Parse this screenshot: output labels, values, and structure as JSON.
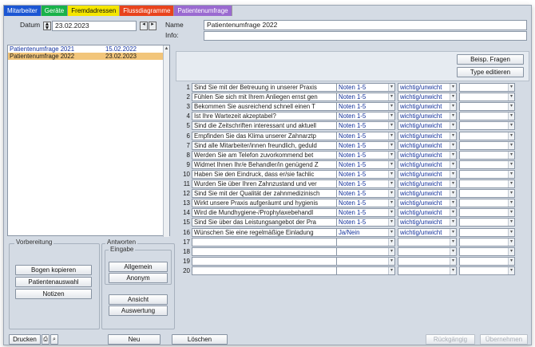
{
  "tabs": [
    {
      "label": "Mitarbeiter",
      "bg": "#1b56d3",
      "fg": "#ffffff"
    },
    {
      "label": "Geräte",
      "bg": "#19b24a",
      "fg": "#ffffff"
    },
    {
      "label": "Fremdadressen",
      "bg": "#f5e600",
      "fg": "#111111"
    },
    {
      "label": "Flussdiagramme",
      "bg": "#e8431c",
      "fg": "#ffffff"
    },
    {
      "label": "Patientenumfrage",
      "bg": "#9a6ad0",
      "fg": "#ffffff"
    }
  ],
  "header": {
    "datum_label": "Datum",
    "datum_value": "23.02.2023",
    "name_label": "Name",
    "name_value": "Patientenumfrage 2022",
    "info_label": "Info:",
    "info_value": ""
  },
  "list": [
    {
      "name": "Patientenumfrage 2021",
      "date": "15.02.2022",
      "selected": false
    },
    {
      "name": "Patientenumfrage 2022",
      "date": "23.02.2023",
      "selected": true
    }
  ],
  "buttons_right": {
    "beisp": "Beisp. Fragen",
    "type": "Type editieren"
  },
  "vorbereitung": {
    "legend": "Vorbereitung",
    "bogen": "Bogen kopieren",
    "patient": "Patientenauswahl",
    "notizen": "Notizen"
  },
  "antworten": {
    "legend": "Antworten",
    "eingabe_legend": "Eingabe",
    "allgemein": "Allgemein",
    "anonym": "Anonym",
    "ansicht": "Ansicht",
    "auswertung": "Auswertung"
  },
  "questions": [
    {
      "n": "1",
      "text": "Sind Sie mit der Betreuung in unserer Praxis",
      "type": "Noten 1-5",
      "weight": "wichtig/unwicht"
    },
    {
      "n": "2",
      "text": "Fühlen Sie sich mit Ihrem Anliegen ernst gen",
      "type": "Noten 1-5",
      "weight": "wichtig/unwicht"
    },
    {
      "n": "3",
      "text": "Bekommen Sie ausreichend schnell einen T",
      "type": "Noten 1-5",
      "weight": "wichtig/unwicht"
    },
    {
      "n": "4",
      "text": "Ist Ihre Wartezeit akzeptabel?",
      "type": "Noten 1-5",
      "weight": "wichtig/unwicht"
    },
    {
      "n": "5",
      "text": "Sind die Zeitschriften interessant und aktuell",
      "type": "Noten 1-5",
      "weight": "wichtig/unwicht"
    },
    {
      "n": "6",
      "text": "Empfinden Sie das Klima unserer Zahnarztp",
      "type": "Noten 1-5",
      "weight": "wichtig/unwicht"
    },
    {
      "n": "7",
      "text": "Sind alle Mitarbeiter/innen freundlich, geduld",
      "type": "Noten 1-5",
      "weight": "wichtig/unwicht"
    },
    {
      "n": "8",
      "text": "Werden Sie am Telefon zuvorkommend bet",
      "type": "Noten 1-5",
      "weight": "wichtig/unwicht"
    },
    {
      "n": "9",
      "text": "Widmet Ihnen Ihr/e Behandler/in genügend Z",
      "type": "Noten 1-5",
      "weight": "wichtig/unwicht"
    },
    {
      "n": "10",
      "text": "Haben Sie den Eindruck, dass er/sie fachlic",
      "type": "Noten 1-5",
      "weight": "wichtig/unwicht"
    },
    {
      "n": "11",
      "text": "Wurden Sie über Ihren Zahnzustand und ver",
      "type": "Noten 1-5",
      "weight": "wichtig/unwicht"
    },
    {
      "n": "12",
      "text": "Sind Sie mit der Qualität der zahnmedizinisch",
      "type": "Noten 1-5",
      "weight": "wichtig/unwicht"
    },
    {
      "n": "13",
      "text": "Wirkt unsere Praxis aufgeräumt und hygienis",
      "type": "Noten 1-5",
      "weight": "wichtig/unwicht"
    },
    {
      "n": "14",
      "text": "Wird die Mundhygiene-/Prophylaxebehandl",
      "type": "Noten 1-5",
      "weight": "wichtig/unwicht"
    },
    {
      "n": "15",
      "text": "Sind Sie über das Leistungsangebot der Pra",
      "type": "Noten 1-5",
      "weight": "wichtig/unwicht"
    },
    {
      "n": "16",
      "text": "Wünschen Sie eine regelmäßige Einladung",
      "type": "Ja/Nein",
      "weight": "wichtig/unwicht"
    },
    {
      "n": "17",
      "text": "",
      "type": "",
      "weight": ""
    },
    {
      "n": "18",
      "text": "",
      "type": "",
      "weight": ""
    },
    {
      "n": "19",
      "text": "",
      "type": "",
      "weight": ""
    },
    {
      "n": "20",
      "text": "",
      "type": "",
      "weight": ""
    }
  ],
  "bottom": {
    "drucken": "Drucken",
    "neu": "Neu",
    "loeschen": "Löschen",
    "rueckgaengig": "Rückgängig",
    "uebernehmen": "Übernehmen"
  }
}
